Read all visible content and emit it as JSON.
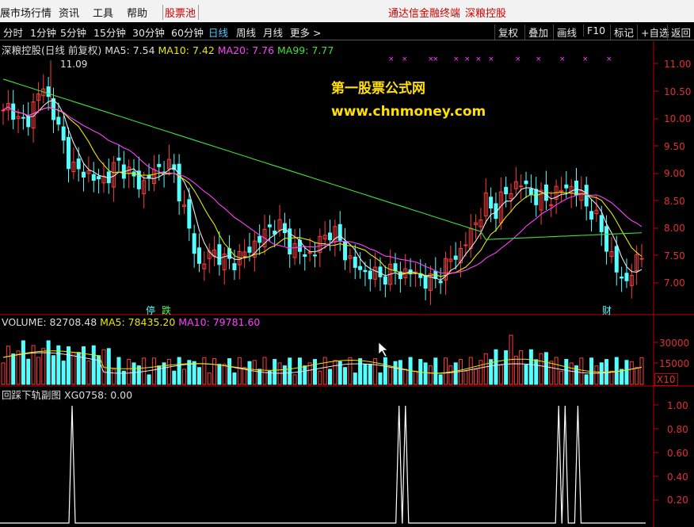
{
  "menubar": {
    "items": [
      "展市场行情",
      "资讯",
      "工具",
      "帮助"
    ],
    "stock_pool": "股票池",
    "right_links": [
      "通达信金融终端",
      "深粮控股"
    ]
  },
  "toolbar": {
    "periods": [
      "分时",
      "1分钟",
      "5分钟",
      "15分钟",
      "30分钟",
      "60分钟",
      "日线",
      "周线",
      "月线",
      "更多 >"
    ],
    "active": "日线",
    "buttons": [
      "复权",
      "叠加",
      "画线",
      "F10",
      "标记",
      "+自选",
      "返回"
    ]
  },
  "main_panel": {
    "stock": "深粮控股(日线 前复权)",
    "ma_labels": [
      {
        "text": "MA5: 7.54",
        "color": "#e8e8e8"
      },
      {
        "text": "MA10: 7.42",
        "color": "#e8e800"
      },
      {
        "text": "MA20: 7.76",
        "color": "#ff40ff"
      },
      {
        "text": "MA99: 7.77",
        "color": "#40e040"
      }
    ],
    "high_label": "11.09",
    "y_ticks": [
      "11.00",
      "10.50",
      "10.00",
      "9.50",
      "9.00",
      "8.50",
      "8.00",
      "7.50",
      "7.00"
    ],
    "markers": [
      "停",
      "跌",
      "财"
    ]
  },
  "volume_panel": {
    "labels": [
      {
        "text": "VOLUME: 82708.48",
        "color": "#e8e8e8"
      },
      {
        "text": "MA5: 78435.20",
        "color": "#e8e800"
      },
      {
        "text": "MA10: 79781.60",
        "color": "#ff40ff"
      }
    ],
    "y_ticks": [
      "30000",
      "15000"
    ],
    "unit": "X10"
  },
  "sub_panel": {
    "title": "回踩下轨副图",
    "value": "XG0758: 0.00",
    "y_ticks": [
      "1.00",
      "0.80",
      "0.60",
      "0.40",
      "0.20"
    ]
  },
  "watermark": {
    "line1": "第一股票公式网",
    "line2": "www.chnmoney.com"
  },
  "colors": {
    "up": "#ff3c3c",
    "down": "#54ffff",
    "ma5": "#e8e8e8",
    "ma10": "#e8e800",
    "ma20": "#ff40ff",
    "ma99": "#40e040",
    "axis": "#c00000"
  },
  "chart_data": [
    {
      "type": "candlestick",
      "price_range": [
        6.6,
        11.3
      ],
      "high": 11.09,
      "ma5": 7.54,
      "ma10": 7.42,
      "ma20": 7.76,
      "ma99": 7.77,
      "approx_close_path": [
        10.1,
        10.3,
        9.9,
        10.0,
        10.4,
        10.6,
        10.2,
        9.7,
        9.3,
        9.0,
        9.1,
        8.9,
        8.9,
        9.0,
        9.2,
        9.1,
        8.9,
        8.8,
        9.0,
        9.1,
        9.2,
        9.0,
        8.4,
        7.8,
        7.3,
        7.5,
        7.6,
        7.4,
        7.4,
        7.5,
        7.6,
        7.8,
        7.9,
        8.1,
        8.0,
        7.7,
        7.6,
        7.5,
        7.6,
        7.8,
        8.0,
        7.8,
        7.5,
        7.3,
        7.2,
        7.2,
        7.1,
        7.2,
        7.2,
        7.2,
        7.2,
        7.1,
        7.0,
        7.1,
        7.3,
        7.5,
        7.6,
        7.9,
        8.2,
        8.5,
        8.3,
        8.6,
        8.7,
        8.9,
        8.7,
        8.6,
        8.5,
        8.6,
        8.7,
        8.8,
        8.7,
        8.5,
        8.3,
        8.0,
        7.6,
        7.2,
        7.0,
        7.3,
        7.5
      ]
    },
    {
      "type": "bar",
      "series": [
        {
          "name": "VOLUME",
          "last": 82708.48
        },
        {
          "name": "MA5",
          "last": 78435.2
        },
        {
          "name": "MA10",
          "last": 79781.6
        }
      ],
      "y_ticks": [
        15000,
        30000
      ]
    },
    {
      "type": "line",
      "series": [
        {
          "name": "XG0758",
          "last": 0.0
        }
      ],
      "ylim": [
        0,
        1
      ],
      "spike_positions": [
        0.108,
        0.62,
        0.63,
        0.87,
        0.88,
        0.9
      ]
    }
  ]
}
